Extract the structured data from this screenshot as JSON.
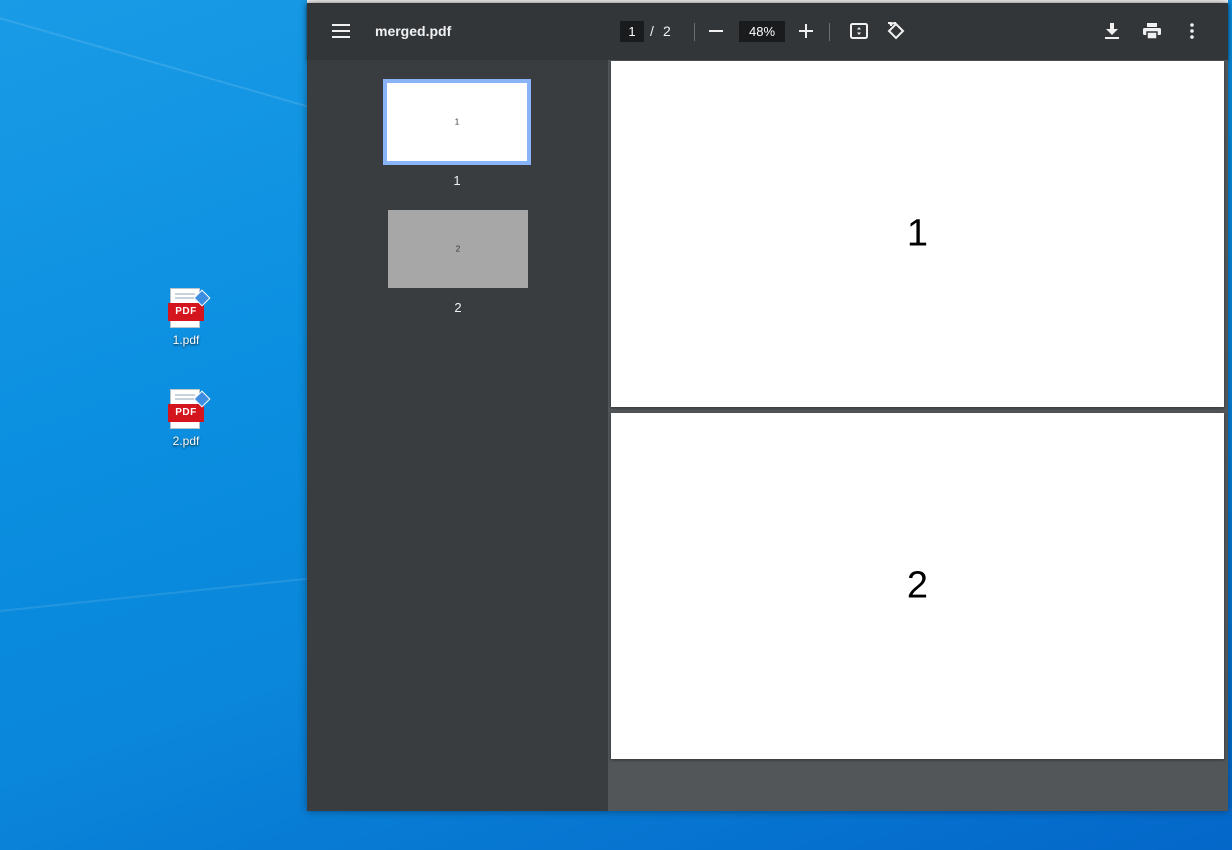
{
  "desktop": {
    "icons": [
      {
        "label": "1.pdf",
        "badge": "PDF"
      },
      {
        "label": "2.pdf",
        "badge": "PDF"
      }
    ]
  },
  "viewer": {
    "title": "merged.pdf",
    "current_page": "1",
    "page_separator": "/",
    "total_pages": "2",
    "zoom": "48%",
    "icons": {
      "menu": "menu-icon",
      "zoom_out": "minus-icon",
      "zoom_in": "plus-icon",
      "fit": "fit-page-icon",
      "rotate": "rotate-icon",
      "download": "download-icon",
      "print": "print-icon",
      "more": "more-vert-icon"
    },
    "thumbnails": [
      {
        "text": "1",
        "number": "1",
        "selected": true
      },
      {
        "text": "2",
        "number": "2",
        "selected": false
      }
    ],
    "pages": [
      {
        "content": "1"
      },
      {
        "content": "2"
      }
    ]
  },
  "colors": {
    "toolbar": "#323639",
    "sidebar": "#3a3d40",
    "canvas": "#525659",
    "selection": "#8ab4f8",
    "pdf_badge": "#d4151d"
  }
}
